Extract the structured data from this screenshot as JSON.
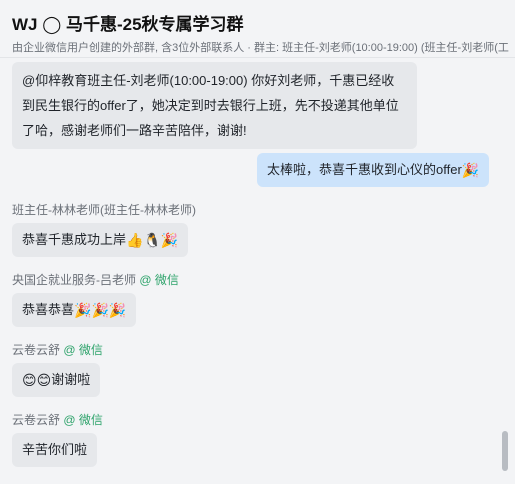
{
  "header": {
    "title": "WJ ◯ 马千惠-25秋专属学习群",
    "subtitle": "由企业微信用户创建的外部群, 含3位外部联系人 · 群主: 班主任-刘老师(10:00-19:00)  (班主任-刘老师(工"
  },
  "messages": {
    "m1": {
      "line1": "@仰梓教育班主任-刘老师(10:00-19:00)   你好刘老师，千惠已经收",
      "line2": "到民生银行的offer了，她决定到时去银行上班，先不投递其他单位",
      "line3": "了哈，感谢老师们一路辛苦陪伴，谢谢!"
    },
    "m2": {
      "text": "太棒啦，恭喜千惠收到心仪的offer",
      "emoji": "🎉"
    },
    "m3": {
      "sender": "班主任-林林老师(班主任-林林老师)",
      "text": "恭喜千惠成功上岸",
      "emoji": "👍🐧🎉"
    },
    "m4": {
      "sender": "央国企就业服务-吕老师",
      "org": "@ 微信",
      "text": "恭喜恭喜",
      "emoji": "🎉🎉🎉"
    },
    "m5": {
      "sender": "云卷云舒",
      "org": "@ 微信",
      "emoji": "😊😊",
      "text": "谢谢啦"
    },
    "m6": {
      "sender": "云卷云舒",
      "org": "@ 微信",
      "text": "辛苦你们啦"
    }
  },
  "icons": {
    "group": "circle-icon",
    "party": "party-popper-icon",
    "thumbs": "thumbs-up-icon",
    "penguin": "penguin-icon",
    "smile": "smile-icon"
  },
  "colors": {
    "incoming_bubble": "#e6e8eb",
    "outgoing_bubble": "#cce3fb",
    "org_tag": "#2ea36b",
    "background": "#f3f4f6"
  }
}
